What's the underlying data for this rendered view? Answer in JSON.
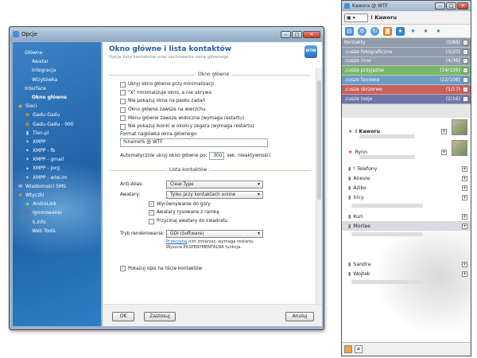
{
  "window": {
    "title": "Opcje"
  },
  "sidebar": {
    "items": [
      {
        "label": "Główne",
        "icon": "none",
        "indent": 1
      },
      {
        "label": "Awatar",
        "icon": "none",
        "indent": 2
      },
      {
        "label": "Integracja",
        "icon": "none",
        "indent": 2
      },
      {
        "label": "Wizytówka",
        "icon": "none",
        "indent": 2
      },
      {
        "label": "Interface",
        "icon": "none",
        "indent": 1
      },
      {
        "label": "Okno główne",
        "icon": "none",
        "indent": 2,
        "selected": true
      },
      {
        "label": "Sieci",
        "icon": "network-icon",
        "indent": 0
      },
      {
        "label": "Gadu-Gadu",
        "icon": "gg-flower-icon",
        "indent": 1
      },
      {
        "label": "Gadu-Gadu - 000",
        "icon": "gg-flower-icon",
        "indent": 1
      },
      {
        "label": "Tlen.pl",
        "icon": "tlen-icon",
        "indent": 1
      },
      {
        "label": "XMPP",
        "icon": "xmpp-bulb-icon",
        "indent": 1
      },
      {
        "label": "XMPP - fb",
        "icon": "xmpp-bulb-icon",
        "indent": 1
      },
      {
        "label": "XMPP - gmail",
        "icon": "xmpp-bulb-icon",
        "indent": 1
      },
      {
        "label": "XMPP - jorg",
        "icon": "xmpp-bulb-icon",
        "indent": 1
      },
      {
        "label": "XMPP - wtw.im",
        "icon": "xmpp-bulb-icon",
        "indent": 1
      },
      {
        "label": "Wiadomości SMS",
        "icon": "sms-icon",
        "indent": 0
      },
      {
        "label": "Wtyczki",
        "icon": "plugin-icon",
        "indent": 0
      },
      {
        "label": "AndroLink",
        "icon": "android-icon",
        "indent": 1
      },
      {
        "label": "Ignorowanie",
        "icon": "ignore-icon",
        "indent": 1
      },
      {
        "label": "k.info",
        "icon": "info-icon",
        "indent": 1
      },
      {
        "label": "Web Tools",
        "icon": "none",
        "indent": 2
      }
    ]
  },
  "main": {
    "title": "Okno główne i lista kontaktów",
    "subtitle": "Opcje listy kontaktów oraz zachowania okna głównego",
    "badge": "WTW",
    "section1": "Okno główne",
    "checks1": [
      {
        "label": "Ukryj okno główne przy minimalizacji",
        "checked": false
      },
      {
        "label": "\"X\" minimalizuje okno, a nie ukrywa",
        "checked": false
      },
      {
        "label": "Nie pokazuj okna na pasku zadań",
        "checked": false
      },
      {
        "label": "Okno główne zawsze na wierzchu",
        "checked": false
      },
      {
        "label": "Menu główne zawsze widoczne (wymaga restartu)",
        "checked": false
      },
      {
        "label": "Nie pokazuj ikonki w okolicy zegara (wymaga restartu)",
        "checked": false
      }
    ],
    "format_label": "Format nagłówka okna głównego:",
    "format_value": "%name% @ WTF",
    "autohide_label": "Automatycznie ukryj okno główne po:",
    "autohide_value": "300",
    "autohide_unit": "sek. nieaktywności",
    "section2": "Lista kontaktów",
    "aa_label": "Anti-Alias:",
    "aa_value": "Clear-Type",
    "av_label": "Awatary:",
    "av_value": "Tylko przy kontaktach online",
    "checks2": [
      {
        "label": "Wyrównywanie do góry",
        "checked": true
      },
      {
        "label": "Awatary rysowane z ramką",
        "checked": true
      },
      {
        "label": "Przycinaj awatary do kwadratu",
        "checked": false
      }
    ],
    "render_label": "Tryb renderowania:",
    "render_value": "GDI (Software)",
    "note_link": "Przeczytaj",
    "note_rest1": " nim zmienisz, wymaga restartu.",
    "note_line2": "Wysoce EKSPERYMENTALNA funkcja.",
    "last_check": "Pokazuj opis na liście kontaktów",
    "ok": "OK",
    "apply": "Zastosuj",
    "cancel": "Anuluj"
  },
  "roster": {
    "title": "Kawora @ WTF",
    "nick": "! Kaworu",
    "groups": [
      {
        "name": "Kontakty",
        "count": "(0/88)",
        "color": "#8f9cab"
      },
      {
        "name": ".cusze fotograficzne",
        "count": "(3/20)",
        "color": "#8f9cab"
      },
      {
        "name": ".cusze inne",
        "count": "(4/36)",
        "color": "#8f9cab"
      },
      {
        "name": ".cusze przyjazne",
        "count": "(14/126)",
        "color": "#7ab76a"
      },
      {
        "name": ".cusze fanowie",
        "count": "(22/108)",
        "color": "#6f9cc4"
      },
      {
        "name": ".cusze skrzerwe",
        "count": "(1/17)",
        "color": "#c9605a"
      },
      {
        "name": ".cusze inoje",
        "count": "(2/16)",
        "color": "#6e77a6"
      }
    ],
    "contacts": [
      {
        "name": "! Kaworu",
        "star": "blue",
        "avatar": true,
        "bold": true
      },
      {
        "name": "Rynn",
        "star": "red",
        "avatar": true,
        "bold": false
      }
    ],
    "subgroups": [
      {
        "name": "! Telefony"
      },
      {
        "name": "Anevie"
      },
      {
        "name": "Aziko"
      },
      {
        "name": "Iricy"
      },
      {
        "name": "Kuri"
      },
      {
        "name": "Mortee",
        "highlight": true
      },
      {
        "name": "Sandra"
      },
      {
        "name": "Wojtek"
      }
    ]
  }
}
